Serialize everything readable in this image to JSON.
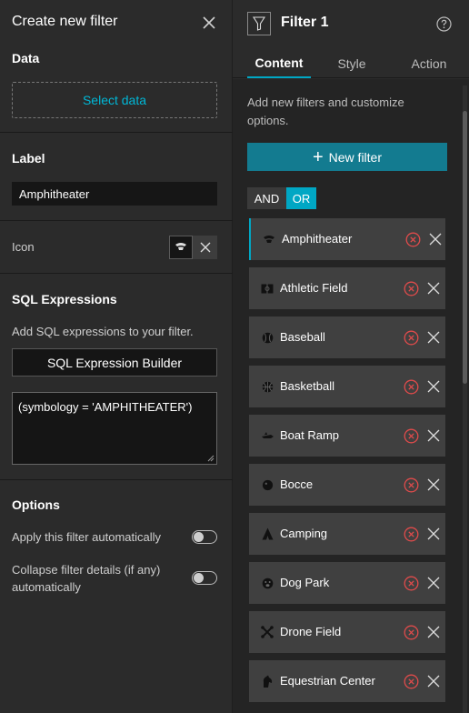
{
  "left": {
    "title": "Create new filter",
    "data": {
      "title": "Data",
      "select_label": "Select data"
    },
    "label": {
      "title": "Label",
      "value": "Amphitheater"
    },
    "icon": {
      "title": "Icon",
      "selected_icon": "amphitheater-icon",
      "clear_icon": "close-icon"
    },
    "sql": {
      "title": "SQL Expressions",
      "description": "Add SQL expressions to your filter.",
      "builder_label": "SQL Expression Builder",
      "expression": "(symbology = 'AMPHITHEATER')"
    },
    "options": {
      "title": "Options",
      "apply_auto": {
        "label": "Apply this filter automatically",
        "on": false
      },
      "collapse": {
        "label": "Collapse filter details (if any) automatically",
        "on": false
      }
    }
  },
  "right": {
    "title": "Filter 1",
    "tabs": [
      {
        "label": "Content",
        "active": true
      },
      {
        "label": "Style",
        "active": false
      },
      {
        "label": "Action",
        "active": false
      }
    ],
    "description": "Add new filters and customize options.",
    "new_filter_label": "New filter",
    "logic": {
      "and_label": "AND",
      "or_label": "OR",
      "selected": "OR"
    },
    "items": [
      {
        "label": "Amphitheater",
        "icon": "amphitheater-icon"
      },
      {
        "label": "Athletic Field",
        "icon": "athletic-field-icon"
      },
      {
        "label": "Baseball",
        "icon": "baseball-icon"
      },
      {
        "label": "Basketball",
        "icon": "basketball-icon"
      },
      {
        "label": "Boat Ramp",
        "icon": "boat-ramp-icon"
      },
      {
        "label": "Bocce",
        "icon": "bocce-icon"
      },
      {
        "label": "Camping",
        "icon": "camping-icon"
      },
      {
        "label": "Dog Park",
        "icon": "dog-park-icon"
      },
      {
        "label": "Drone Field",
        "icon": "drone-field-icon"
      },
      {
        "label": "Equestrian Center",
        "icon": "equestrian-center-icon"
      }
    ]
  },
  "colors": {
    "accent": "#00a7c4",
    "primary_button": "#137b90",
    "danger": "#e04b4b",
    "panel": "#2b2b2b",
    "list_bg": "#242424"
  }
}
